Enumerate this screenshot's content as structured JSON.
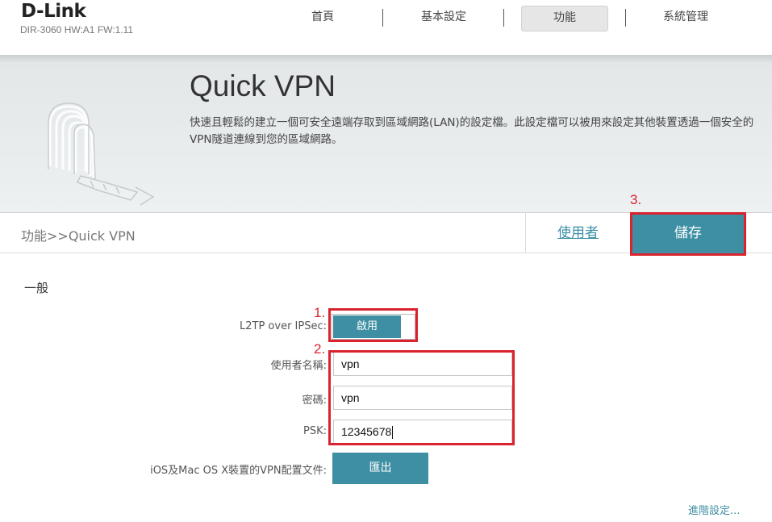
{
  "header": {
    "logo": "D-Link",
    "model": "DIR-3060 HW:A1 FW:1.11",
    "nav": [
      {
        "label": "首頁",
        "active": false
      },
      {
        "label": "基本設定",
        "active": false
      },
      {
        "label": "功能",
        "active": true
      },
      {
        "label": "系統管理",
        "active": false
      }
    ]
  },
  "hero": {
    "title": "Quick VPN",
    "description": "快速且輕鬆的建立一個可安全遠端存取到區域網路(LAN)的設定檔。此設定檔可以被用來設定其他裝置透過一個安全的VPN隧道連線到您的區域網路。",
    "illustration": "vpn-tunnel-icon"
  },
  "breadcrumb": "功能>>Quick VPN",
  "tabs": {
    "user_label": "使用者",
    "save_label": "儲存"
  },
  "annotations": {
    "step1": "1.",
    "step2": "2.",
    "step3": "3."
  },
  "form": {
    "section_title": "一般",
    "l2tp_label": "L2TP over IPSec:",
    "l2tp_state": "啟用",
    "username_label": "使用者名稱:",
    "username_value": "vpn",
    "password_label": "密碼:",
    "password_value": "vpn",
    "psk_label": "PSK:",
    "psk_value": "12345678",
    "profile_label": "iOS及Mac OS X裝置的VPN配置文件:",
    "export_label": "匯出",
    "advanced_link": "進階設定..."
  },
  "colors": {
    "accent": "#3e8fa3",
    "annotation_red": "#d9232e",
    "link": "#3f8fa6"
  }
}
